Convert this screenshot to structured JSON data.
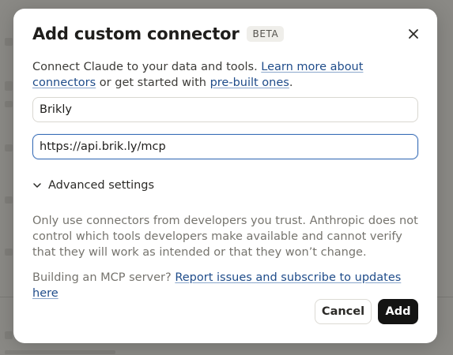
{
  "dialog": {
    "title": "Add custom connector",
    "badge": "BETA",
    "close_icon": "close-icon",
    "description": {
      "prefix": "Connect Claude to your data and tools. ",
      "link1": "Learn more about connectors",
      "middle": " or get started with ",
      "link2": "pre-built ones",
      "suffix": "."
    },
    "name_field": {
      "value": "Brikly"
    },
    "url_field": {
      "value": "https://api.brik.ly/mcp"
    },
    "advanced_settings": {
      "label": "Advanced settings",
      "icon": "chevron-down-icon"
    },
    "warning": "Only use connectors from developers you trust. Anthropic does not control which tools developers make available and cannot verify that they will work as intended or that they won’t change.",
    "mcp_prompt": {
      "prefix": "Building an MCP server? ",
      "link": "Report issues and subscribe to updates here"
    },
    "buttons": {
      "cancel": "Cancel",
      "add": "Add"
    }
  },
  "colors": {
    "accent_focus": "#3a6fb8",
    "link": "#1f4c8a",
    "primary_button": "#141413",
    "backdrop": "#8a8985"
  }
}
